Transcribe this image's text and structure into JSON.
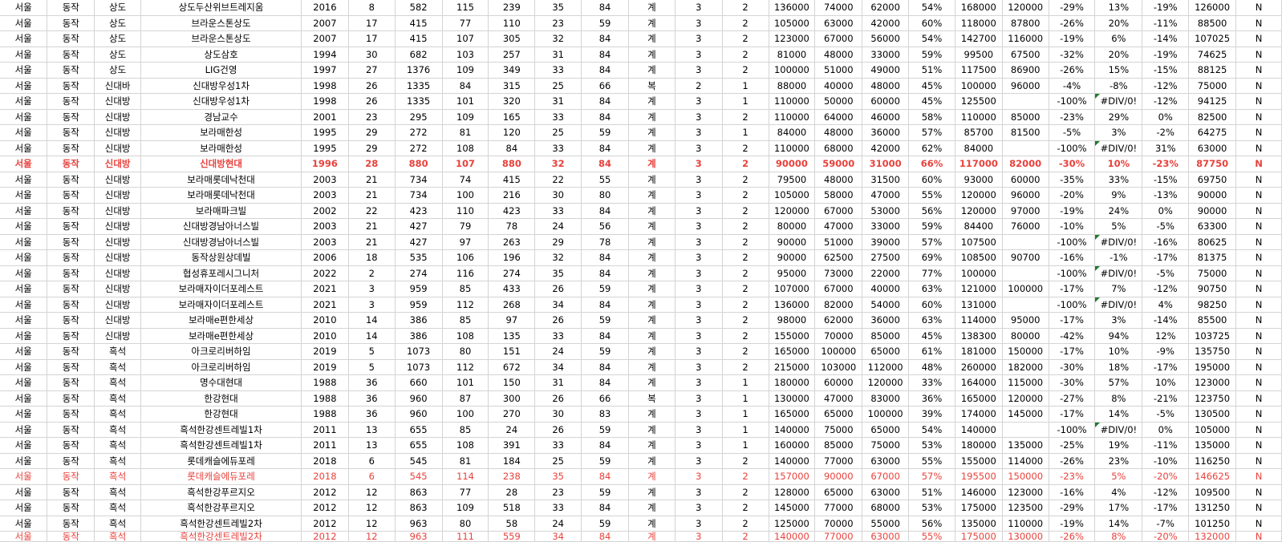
{
  "rows": [
    {
      "style": "",
      "err": false,
      "cells": [
        "서울",
        "동작",
        "상도",
        "상도두산위브트레지움",
        "2016",
        "8",
        "582",
        "115",
        "239",
        "35",
        "84",
        "계",
        "3",
        "2",
        "136000",
        "74000",
        "62000",
        "54%",
        "168000",
        "120000",
        "-29%",
        "13%",
        "-19%",
        "126000",
        "N"
      ]
    },
    {
      "style": "",
      "err": false,
      "cells": [
        "서울",
        "동작",
        "상도",
        "브라운스톤상도",
        "2007",
        "17",
        "415",
        "77",
        "110",
        "23",
        "59",
        "계",
        "3",
        "2",
        "105000",
        "63000",
        "42000",
        "60%",
        "118000",
        "87800",
        "-26%",
        "20%",
        "-11%",
        "88500",
        "N"
      ]
    },
    {
      "style": "",
      "err": false,
      "cells": [
        "서울",
        "동작",
        "상도",
        "브라운스톤상도",
        "2007",
        "17",
        "415",
        "107",
        "305",
        "32",
        "84",
        "계",
        "3",
        "2",
        "123000",
        "67000",
        "56000",
        "54%",
        "142700",
        "116000",
        "-19%",
        "6%",
        "-14%",
        "107025",
        "N"
      ]
    },
    {
      "style": "",
      "err": false,
      "cells": [
        "서울",
        "동작",
        "상도",
        "상도삼호",
        "1994",
        "30",
        "682",
        "103",
        "257",
        "31",
        "84",
        "계",
        "3",
        "2",
        "81000",
        "48000",
        "33000",
        "59%",
        "99500",
        "67500",
        "-32%",
        "20%",
        "-19%",
        "74625",
        "N"
      ]
    },
    {
      "style": "",
      "err": false,
      "cells": [
        "서울",
        "동작",
        "상도",
        "LIG건영",
        "1997",
        "27",
        "1376",
        "109",
        "349",
        "33",
        "84",
        "계",
        "3",
        "2",
        "100000",
        "51000",
        "49000",
        "51%",
        "117500",
        "86900",
        "-26%",
        "15%",
        "-15%",
        "88125",
        "N"
      ]
    },
    {
      "style": "",
      "err": false,
      "cells": [
        "서울",
        "동작",
        "신대바",
        "신대방우성1차",
        "1998",
        "26",
        "1335",
        "84",
        "315",
        "25",
        "66",
        "복",
        "2",
        "1",
        "88000",
        "40000",
        "48000",
        "45%",
        "100000",
        "96000",
        "-4%",
        "-8%",
        "-12%",
        "75000",
        "N"
      ]
    },
    {
      "style": "",
      "err": true,
      "cells": [
        "서울",
        "동작",
        "신대방",
        "신대방우성1차",
        "1998",
        "26",
        "1335",
        "101",
        "320",
        "31",
        "84",
        "계",
        "3",
        "1",
        "110000",
        "50000",
        "60000",
        "45%",
        "125500",
        "",
        "-100%",
        "#DIV/0!",
        "-12%",
        "94125",
        "N"
      ]
    },
    {
      "style": "",
      "err": false,
      "cells": [
        "서울",
        "동작",
        "신대방",
        "경남교수",
        "2001",
        "23",
        "295",
        "109",
        "165",
        "33",
        "84",
        "계",
        "3",
        "2",
        "110000",
        "64000",
        "46000",
        "58%",
        "110000",
        "85000",
        "-23%",
        "29%",
        "0%",
        "82500",
        "N"
      ]
    },
    {
      "style": "",
      "err": false,
      "cells": [
        "서울",
        "동작",
        "신대방",
        "보라매한성",
        "1995",
        "29",
        "272",
        "81",
        "120",
        "25",
        "59",
        "계",
        "3",
        "1",
        "84000",
        "48000",
        "36000",
        "57%",
        "85700",
        "81500",
        "-5%",
        "3%",
        "-2%",
        "64275",
        "N"
      ]
    },
    {
      "style": "",
      "err": true,
      "cells": [
        "서울",
        "동작",
        "신대방",
        "보라매한성",
        "1995",
        "29",
        "272",
        "108",
        "84",
        "33",
        "84",
        "계",
        "3",
        "2",
        "110000",
        "68000",
        "42000",
        "62%",
        "84000",
        "",
        "-100%",
        "#DIV/0!",
        "31%",
        "63000",
        "N"
      ]
    },
    {
      "style": "hlb",
      "err": false,
      "cells": [
        "서울",
        "동작",
        "신대방",
        "신대방현대",
        "1996",
        "28",
        "880",
        "107",
        "880",
        "32",
        "84",
        "계",
        "3",
        "2",
        "90000",
        "59000",
        "31000",
        "66%",
        "117000",
        "82000",
        "-30%",
        "10%",
        "-23%",
        "87750",
        "N"
      ]
    },
    {
      "style": "",
      "err": false,
      "cells": [
        "서울",
        "동작",
        "신대방",
        "보라매롯데낙천대",
        "2003",
        "21",
        "734",
        "74",
        "415",
        "22",
        "55",
        "계",
        "3",
        "2",
        "79500",
        "48000",
        "31500",
        "60%",
        "93000",
        "60000",
        "-35%",
        "33%",
        "-15%",
        "69750",
        "N"
      ]
    },
    {
      "style": "",
      "err": false,
      "cells": [
        "서울",
        "동작",
        "신대방",
        "보라매롯데낙천대",
        "2003",
        "21",
        "734",
        "100",
        "216",
        "30",
        "80",
        "계",
        "3",
        "2",
        "105000",
        "58000",
        "47000",
        "55%",
        "120000",
        "96000",
        "-20%",
        "9%",
        "-13%",
        "90000",
        "N"
      ]
    },
    {
      "style": "",
      "err": false,
      "cells": [
        "서울",
        "동작",
        "신대방",
        "보라매파크빌",
        "2002",
        "22",
        "423",
        "110",
        "423",
        "33",
        "84",
        "계",
        "3",
        "2",
        "120000",
        "67000",
        "53000",
        "56%",
        "120000",
        "97000",
        "-19%",
        "24%",
        "0%",
        "90000",
        "N"
      ]
    },
    {
      "style": "",
      "err": false,
      "cells": [
        "서울",
        "동작",
        "신대방",
        "신대방경남아너스빌",
        "2003",
        "21",
        "427",
        "79",
        "78",
        "24",
        "56",
        "계",
        "3",
        "2",
        "80000",
        "47000",
        "33000",
        "59%",
        "84400",
        "76000",
        "-10%",
        "5%",
        "-5%",
        "63300",
        "N"
      ]
    },
    {
      "style": "",
      "err": true,
      "cells": [
        "서울",
        "동작",
        "신대방",
        "신대방경남아너스빌",
        "2003",
        "21",
        "427",
        "97",
        "263",
        "29",
        "78",
        "계",
        "3",
        "2",
        "90000",
        "51000",
        "39000",
        "57%",
        "107500",
        "",
        "-100%",
        "#DIV/0!",
        "-16%",
        "80625",
        "N"
      ]
    },
    {
      "style": "",
      "err": false,
      "cells": [
        "서울",
        "동작",
        "신대방",
        "동작상원상데빌",
        "2006",
        "18",
        "535",
        "106",
        "196",
        "32",
        "84",
        "계",
        "3",
        "2",
        "90000",
        "62500",
        "27500",
        "69%",
        "108500",
        "90700",
        "-16%",
        "-1%",
        "-17%",
        "81375",
        "N"
      ]
    },
    {
      "style": "",
      "err": true,
      "cells": [
        "서울",
        "동작",
        "신대방",
        "협성휴포레시그니처",
        "2022",
        "2",
        "274",
        "116",
        "274",
        "35",
        "84",
        "계",
        "3",
        "2",
        "95000",
        "73000",
        "22000",
        "77%",
        "100000",
        "",
        "-100%",
        "#DIV/0!",
        "-5%",
        "75000",
        "N"
      ]
    },
    {
      "style": "",
      "err": false,
      "cells": [
        "서울",
        "동작",
        "신대방",
        "보라매자이더포레스트",
        "2021",
        "3",
        "959",
        "85",
        "433",
        "26",
        "59",
        "계",
        "3",
        "2",
        "107000",
        "67000",
        "40000",
        "63%",
        "121000",
        "100000",
        "-17%",
        "7%",
        "-12%",
        "90750",
        "N"
      ]
    },
    {
      "style": "",
      "err": true,
      "cells": [
        "서울",
        "동작",
        "신대방",
        "보라매자이더포레스트",
        "2021",
        "3",
        "959",
        "112",
        "268",
        "34",
        "84",
        "계",
        "3",
        "2",
        "136000",
        "82000",
        "54000",
        "60%",
        "131000",
        "",
        "-100%",
        "#DIV/0!",
        "4%",
        "98250",
        "N"
      ]
    },
    {
      "style": "",
      "err": false,
      "cells": [
        "서울",
        "동작",
        "신대방",
        "보라매e편한세상",
        "2010",
        "14",
        "386",
        "85",
        "97",
        "26",
        "59",
        "계",
        "3",
        "2",
        "98000",
        "62000",
        "36000",
        "63%",
        "114000",
        "95000",
        "-17%",
        "3%",
        "-14%",
        "85500",
        "N"
      ]
    },
    {
      "style": "",
      "err": false,
      "cells": [
        "서울",
        "동작",
        "신대방",
        "보라매e편한세상",
        "2010",
        "14",
        "386",
        "108",
        "135",
        "33",
        "84",
        "계",
        "3",
        "2",
        "155000",
        "70000",
        "85000",
        "45%",
        "138300",
        "80000",
        "-42%",
        "94%",
        "12%",
        "103725",
        "N"
      ]
    },
    {
      "style": "",
      "err": false,
      "cells": [
        "서울",
        "동작",
        "흑석",
        "아크로리버하임",
        "2019",
        "5",
        "1073",
        "80",
        "151",
        "24",
        "59",
        "계",
        "3",
        "2",
        "165000",
        "100000",
        "65000",
        "61%",
        "181000",
        "150000",
        "-17%",
        "10%",
        "-9%",
        "135750",
        "N"
      ]
    },
    {
      "style": "",
      "err": false,
      "cells": [
        "서울",
        "동작",
        "흑석",
        "아크로리버하임",
        "2019",
        "5",
        "1073",
        "112",
        "672",
        "34",
        "84",
        "계",
        "3",
        "2",
        "215000",
        "103000",
        "112000",
        "48%",
        "260000",
        "182000",
        "-30%",
        "18%",
        "-17%",
        "195000",
        "N"
      ]
    },
    {
      "style": "",
      "err": false,
      "cells": [
        "서울",
        "동작",
        "흑석",
        "명수대현대",
        "1988",
        "36",
        "660",
        "101",
        "150",
        "31",
        "84",
        "계",
        "3",
        "1",
        "180000",
        "60000",
        "120000",
        "33%",
        "164000",
        "115000",
        "-30%",
        "57%",
        "10%",
        "123000",
        "N"
      ]
    },
    {
      "style": "",
      "err": false,
      "cells": [
        "서울",
        "동작",
        "흑석",
        "한강현대",
        "1988",
        "36",
        "960",
        "87",
        "300",
        "26",
        "66",
        "복",
        "3",
        "1",
        "130000",
        "47000",
        "83000",
        "36%",
        "165000",
        "120000",
        "-27%",
        "8%",
        "-21%",
        "123750",
        "N"
      ]
    },
    {
      "style": "",
      "err": false,
      "cells": [
        "서울",
        "동작",
        "흑석",
        "한강현대",
        "1988",
        "36",
        "960",
        "100",
        "270",
        "30",
        "83",
        "계",
        "3",
        "1",
        "165000",
        "65000",
        "100000",
        "39%",
        "174000",
        "145000",
        "-17%",
        "14%",
        "-5%",
        "130500",
        "N"
      ]
    },
    {
      "style": "",
      "err": true,
      "cells": [
        "서울",
        "동작",
        "흑석",
        "흑석한강센트레빌1차",
        "2011",
        "13",
        "655",
        "85",
        "24",
        "26",
        "59",
        "계",
        "3",
        "1",
        "140000",
        "75000",
        "65000",
        "54%",
        "140000",
        "",
        "-100%",
        "#DIV/0!",
        "0%",
        "105000",
        "N"
      ]
    },
    {
      "style": "",
      "err": false,
      "cells": [
        "서울",
        "동작",
        "흑석",
        "흑석한강센트레빌1차",
        "2011",
        "13",
        "655",
        "108",
        "391",
        "33",
        "84",
        "계",
        "3",
        "1",
        "160000",
        "85000",
        "75000",
        "53%",
        "180000",
        "135000",
        "-25%",
        "19%",
        "-11%",
        "135000",
        "N"
      ]
    },
    {
      "style": "",
      "err": false,
      "cells": [
        "서울",
        "동작",
        "흑석",
        "롯데캐슬에듀포레",
        "2018",
        "6",
        "545",
        "81",
        "184",
        "25",
        "59",
        "계",
        "3",
        "2",
        "140000",
        "77000",
        "63000",
        "55%",
        "155000",
        "114000",
        "-26%",
        "23%",
        "-10%",
        "116250",
        "N"
      ]
    },
    {
      "style": "hl",
      "err": false,
      "cells": [
        "서울",
        "동작",
        "흑석",
        "롯데캐슬에듀포레",
        "2018",
        "6",
        "545",
        "114",
        "238",
        "35",
        "84",
        "계",
        "3",
        "2",
        "157000",
        "90000",
        "67000",
        "57%",
        "195500",
        "150000",
        "-23%",
        "5%",
        "-20%",
        "146625",
        "N"
      ]
    },
    {
      "style": "",
      "err": false,
      "cells": [
        "서울",
        "동작",
        "흑석",
        "흑석한강푸르지오",
        "2012",
        "12",
        "863",
        "77",
        "28",
        "23",
        "59",
        "계",
        "3",
        "2",
        "128000",
        "65000",
        "63000",
        "51%",
        "146000",
        "123000",
        "-16%",
        "4%",
        "-12%",
        "109500",
        "N"
      ]
    },
    {
      "style": "",
      "err": false,
      "cells": [
        "서울",
        "동작",
        "흑석",
        "흑석한강푸르지오",
        "2012",
        "12",
        "863",
        "109",
        "518",
        "33",
        "84",
        "계",
        "3",
        "2",
        "145000",
        "77000",
        "68000",
        "53%",
        "175000",
        "123500",
        "-29%",
        "17%",
        "-17%",
        "131250",
        "N"
      ]
    },
    {
      "style": "",
      "err": false,
      "cells": [
        "서울",
        "동작",
        "흑석",
        "흑석한강센트레빌2차",
        "2012",
        "12",
        "963",
        "80",
        "58",
        "24",
        "59",
        "계",
        "3",
        "2",
        "125000",
        "70000",
        "55000",
        "56%",
        "135000",
        "110000",
        "-19%",
        "14%",
        "-7%",
        "101250",
        "N"
      ]
    },
    {
      "style": "hl",
      "err": false,
      "cells": [
        "서울",
        "동작",
        "흑석",
        "흑석한강센트레빌2차",
        "2012",
        "12",
        "963",
        "111",
        "559",
        "34",
        "84",
        "계",
        "3",
        "2",
        "140000",
        "77000",
        "63000",
        "55%",
        "175000",
        "130000",
        "-26%",
        "8%",
        "-20%",
        "132000",
        "N"
      ]
    }
  ]
}
